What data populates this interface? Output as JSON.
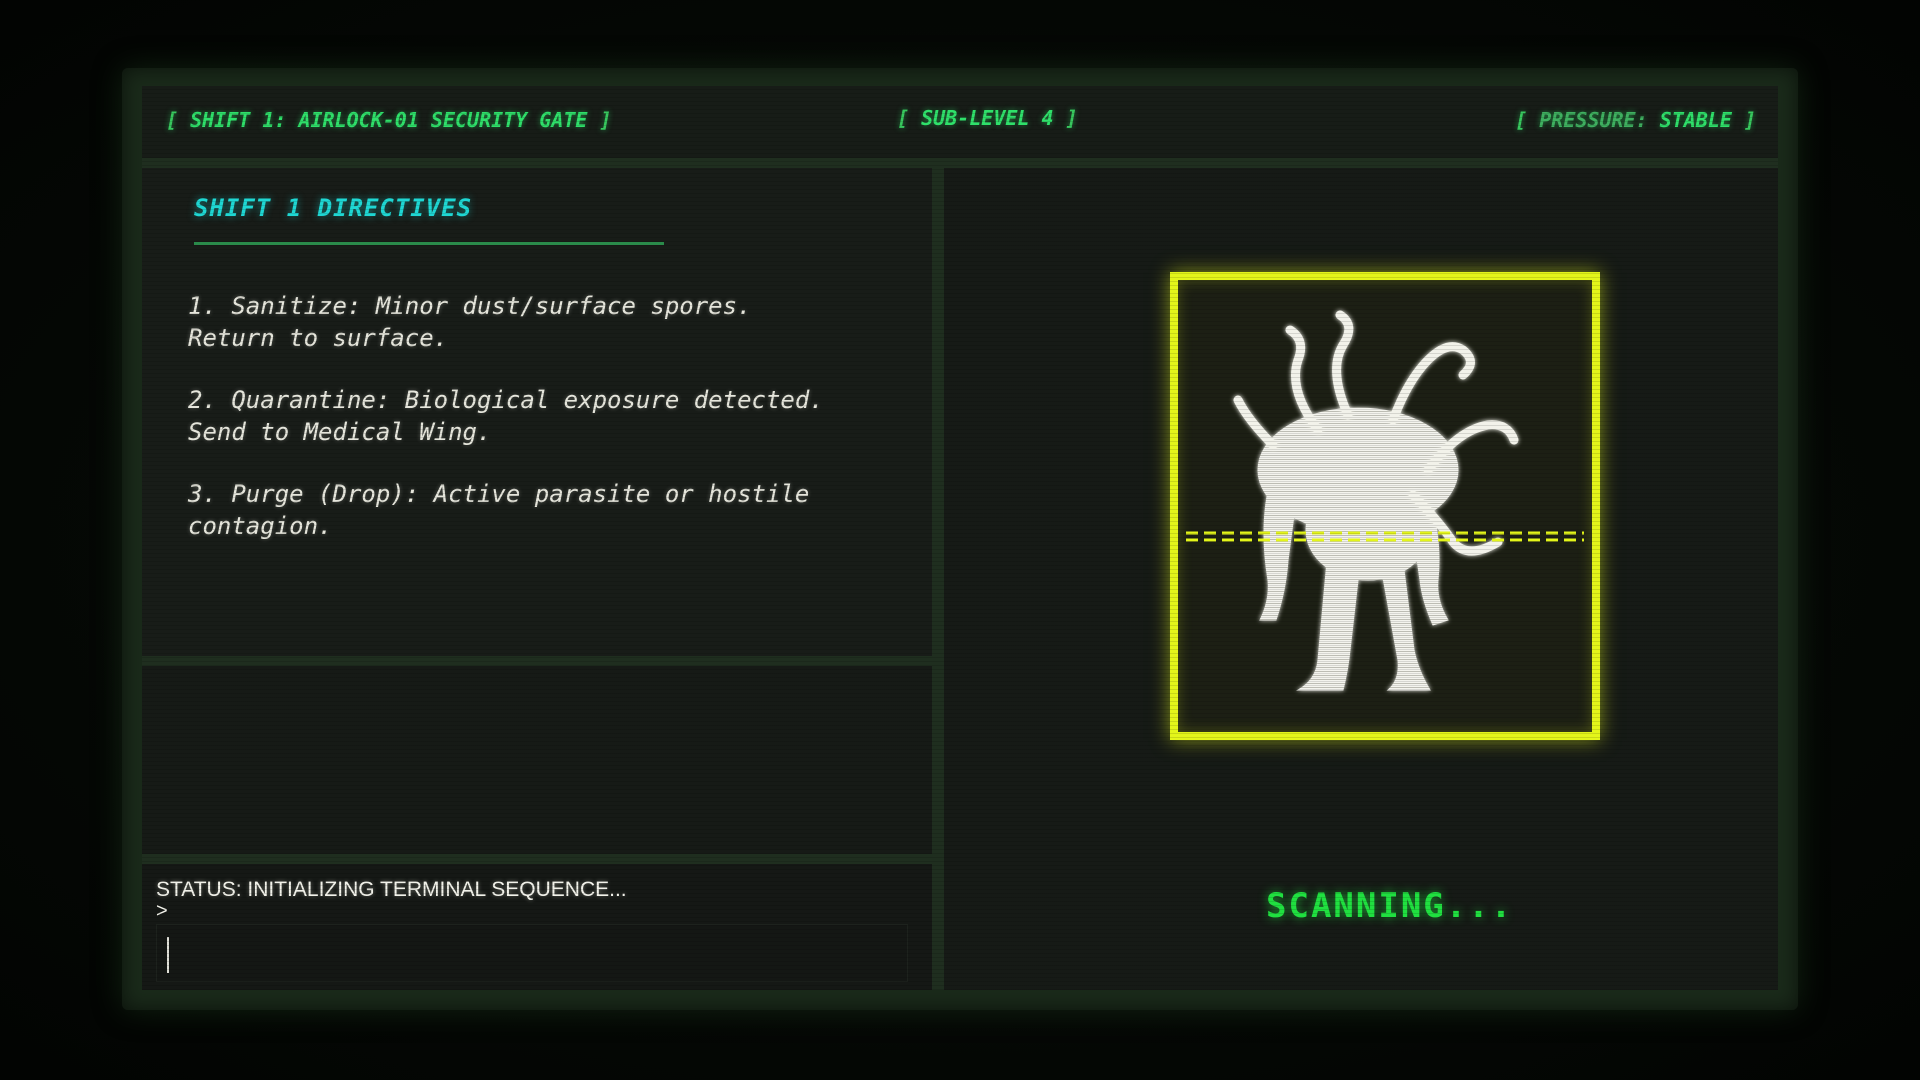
{
  "header": {
    "left_prefix": "[ ",
    "left_text": "SHIFT 1: AIRLOCK-01 SECURITY GATE",
    "left_suffix": " ]",
    "center_prefix": "[ ",
    "center_text": "SUB-LEVEL 4",
    "center_suffix": " ]",
    "right_prefix": "[ ",
    "right_label": "PRESSURE: ",
    "right_value": "STABLE",
    "right_suffix": " ]"
  },
  "directives": {
    "title": "SHIFT 1 DIRECTIVES",
    "items": [
      {
        "text": "1. Sanitize: Minor dust/surface spores.\nReturn to surface."
      },
      {
        "text": "2. Quarantine: Biological exposure detected.\nSend to Medical Wing."
      },
      {
        "text": "3. Purge (Drop): Active parasite or hostile\ncontagion."
      }
    ]
  },
  "terminal": {
    "status": "STATUS: INITIALIZING TERMINAL SEQUENCE...",
    "prompt": ">",
    "input_value": ""
  },
  "scanner": {
    "subject_icon": "tentacled-creature-icon",
    "status": "SCANNING...",
    "frame_color": "#e3f51a",
    "status_color": "#20e040"
  },
  "colors": {
    "header_text": "#2fe06a",
    "title_cyan": "#1fd7d3",
    "body_text": "#e6e6dc"
  }
}
